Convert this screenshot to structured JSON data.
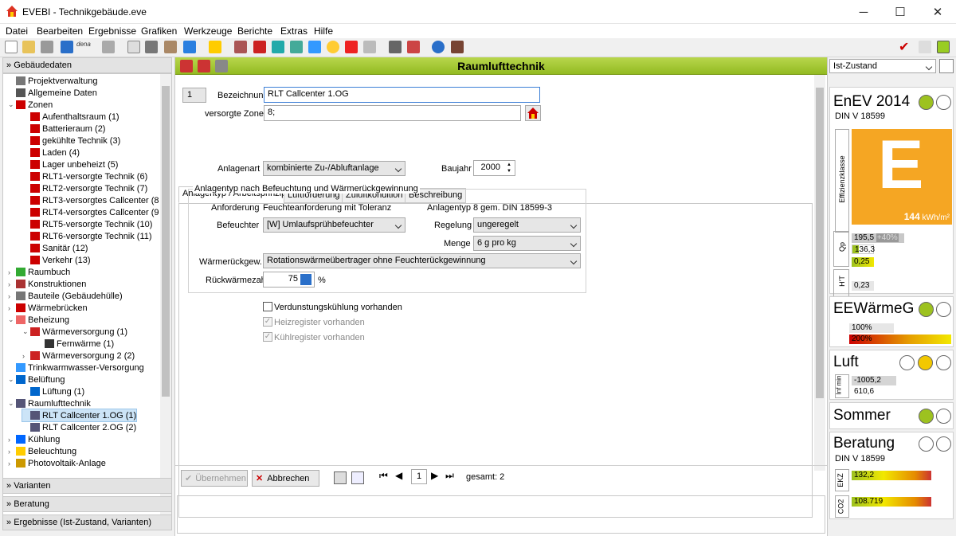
{
  "window": {
    "title": "EVEBI - Technikgebäude.eve",
    "minimize": "─",
    "maximize": "☐",
    "close": "✕"
  },
  "menu": [
    "Datei",
    "Bearbeiten",
    "Ergebnisse",
    "Grafiken",
    "Werkzeuge",
    "Berichte",
    "Extras",
    "Hilfe"
  ],
  "toolbar": {
    "dena_label": "dena"
  },
  "left": {
    "header": "Gebäudedaten",
    "tree": [
      {
        "label": "Projektverwaltung",
        "level": 1,
        "color": "#777"
      },
      {
        "label": "Allgemeine Daten",
        "level": 1,
        "color": "#555"
      },
      {
        "label": "Zonen",
        "level": 1,
        "color": "#c00",
        "expanded": true
      },
      {
        "label": "Aufenthaltsraum (1)",
        "level": 2,
        "color": "#c00"
      },
      {
        "label": "Batterieraum (2)",
        "level": 2,
        "color": "#c00"
      },
      {
        "label": "gekühlte Technik (3)",
        "level": 2,
        "color": "#c00"
      },
      {
        "label": "Laden (4)",
        "level": 2,
        "color": "#c00"
      },
      {
        "label": "Lager unbeheizt (5)",
        "level": 2,
        "color": "#c00"
      },
      {
        "label": "RLT1-versorgte Technik (6)",
        "level": 2,
        "color": "#c00"
      },
      {
        "label": "RLT2-versorgte Technik (7)",
        "level": 2,
        "color": "#c00"
      },
      {
        "label": "RLT3-versorgtes Callcenter (8",
        "level": 2,
        "color": "#c00"
      },
      {
        "label": "RLT4-versorgtes Callcenter (9",
        "level": 2,
        "color": "#c00"
      },
      {
        "label": "RLT5-versorgte Technik (10)",
        "level": 2,
        "color": "#c00"
      },
      {
        "label": "RLT6-versorgte Technik (11)",
        "level": 2,
        "color": "#c00"
      },
      {
        "label": "Sanitär (12)",
        "level": 2,
        "color": "#c00"
      },
      {
        "label": "Verkehr (13)",
        "level": 2,
        "color": "#c00"
      },
      {
        "label": "Raumbuch",
        "level": 1,
        "color": "#3a3",
        "collapsed": true
      },
      {
        "label": "Konstruktionen",
        "level": 1,
        "color": "#a33",
        "collapsed": true
      },
      {
        "label": "Bauteile (Gebäudehülle)",
        "level": 1,
        "color": "#777",
        "collapsed": true
      },
      {
        "label": "Wärmebrücken",
        "level": 1,
        "color": "#c00",
        "collapsed": true
      },
      {
        "label": "Beheizung",
        "level": 1,
        "color": "#e66",
        "expanded": true
      },
      {
        "label": "Wärmeversorgung (1)",
        "level": 2,
        "color": "#c22",
        "expanded": true
      },
      {
        "label": "Fernwärme (1)",
        "level": 3,
        "color": "#333"
      },
      {
        "label": "Wärmeversorgung 2 (2)",
        "level": 2,
        "color": "#c22",
        "collapsed": true
      },
      {
        "label": "Trinkwarmwasser-Versorgung",
        "level": 1,
        "color": "#39f"
      },
      {
        "label": "Belüftung",
        "level": 1,
        "color": "#06c",
        "expanded": true
      },
      {
        "label": "Lüftung (1)",
        "level": 2,
        "color": "#06c"
      },
      {
        "label": "Raumlufttechnik",
        "level": 1,
        "color": "#557",
        "expanded": true
      },
      {
        "label": "RLT Callcenter 1.OG (1)",
        "level": 2,
        "color": "#557",
        "selected": true
      },
      {
        "label": "RLT Callcenter 2.OG (2)",
        "level": 2,
        "color": "#557"
      },
      {
        "label": "Kühlung",
        "level": 1,
        "color": "#06f",
        "collapsed": true
      },
      {
        "label": "Beleuchtung",
        "level": 1,
        "color": "#fc0",
        "collapsed": true
      },
      {
        "label": "Photovoltaik-Anlage",
        "level": 1,
        "color": "#c90",
        "collapsed": true
      }
    ],
    "sections": [
      "Varianten",
      "Beratung",
      "Ergebnisse (Ist-Zustand, Varianten)"
    ]
  },
  "main": {
    "title": "Raumlufttechnik",
    "number": "1",
    "bezeichnung_label": "Bezeichnung",
    "bezeichnung_value": "RLT Callcenter 1.OG",
    "zonen_label": "versorgte Zonen",
    "zonen_value": "8;",
    "tabs": [
      "Anlagentyp / Arbeitsprinzip",
      "Luftförderung",
      "Zuluftkondition",
      "Beschreibung"
    ],
    "anlagenart_label": "Anlagenart",
    "anlagenart_value": "kombinierte Zu-/Abluftanlage",
    "baujahr_label": "Baujahr",
    "baujahr_value": "2000",
    "group_title": "Anlagentyp nach Befeuchtung und Wärmerückgewinnung",
    "anforderung_label": "Anforderung",
    "anforderung_value": "Feuchteanforderung mit Toleranz",
    "anlagentyp_label": "Anlagentyp",
    "anlagentyp_value": "8 gem. DIN 18599-3",
    "befeuchter_label": "Befeuchter",
    "befeuchter_value": "[W] Umlaufsprühbefeuchter",
    "regelung_label": "Regelung",
    "regelung_value": "ungeregelt",
    "menge_label": "Menge",
    "menge_value": "6 g pro kg",
    "wrg_label": "Wärmerückgew.",
    "wrg_value": "Rotationswärmeübertrager ohne Feuchterückgewinnung",
    "rueck_label": "Rückwärmezahl",
    "rueck_value": "75",
    "rueck_unit": "%",
    "cb1": "Verdunstungskühlung vorhanden",
    "cb2": "Heizregister vorhanden",
    "cb3": "Kühlregister vorhanden",
    "btn_apply": "Übernehmen",
    "btn_cancel": "Abbrechen",
    "page": "1",
    "total": "gesamt: 2"
  },
  "right": {
    "state": "Ist-Zustand",
    "enev_title": "EnEV 2014",
    "enev_norm": "DIN V 18599",
    "effizienz_label": "Effizienzklasse",
    "effizienz_class": "E",
    "effizienz_value": "144",
    "effizienz_unit": "kWh/m²",
    "qp_label": "Qp",
    "qp_v1": "195,5",
    "qp_v2": "+40%",
    "qp_v3": "136,3",
    "ht_label": "H'T",
    "ht_v1": "0,25",
    "ht_v2": "0,23",
    "ee_title": "EEWärmeG",
    "ee_v1": "100%",
    "ee_v2": "200%",
    "luft_title": "Luft",
    "luft_label": "Inf min",
    "luft_v1": "-1005,2",
    "luft_v2": "610,6",
    "sommer_title": "Sommer",
    "beratung_title": "Beratung",
    "beratung_norm": "DIN V 18599",
    "ekz_label": "EKZ",
    "ekz_value": "132,2",
    "co2_label": "CO2",
    "co2_value": "108.719",
    "colors": {
      "green": "#9dc21f",
      "yellow": "#f2c800",
      "orange": "#f5a623"
    }
  }
}
